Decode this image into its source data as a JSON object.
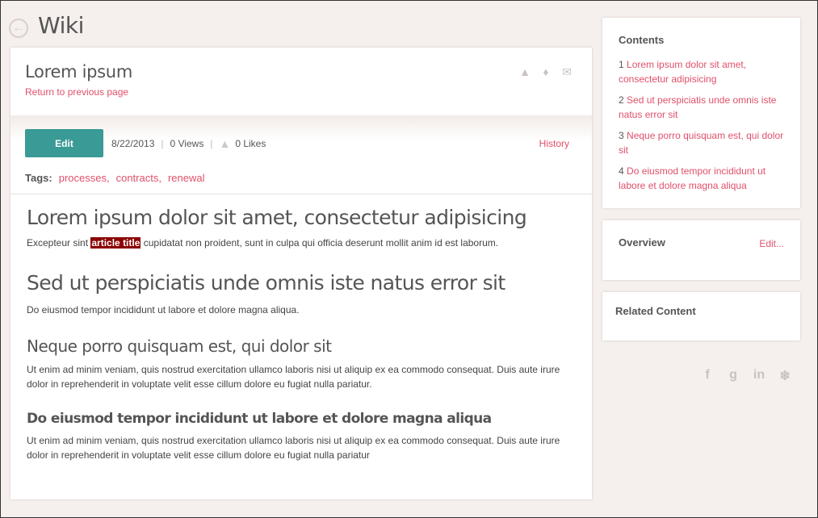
{
  "header": {
    "title": "Wiki",
    "back_icon": "arrow-left-circle-icon"
  },
  "article": {
    "title": "Lorem ipsum",
    "return_link": "Return to previous page",
    "actions": {
      "edit_label": "Edit",
      "history_label": "History"
    },
    "meta": {
      "date": "8/22/2013",
      "views": "0 Views",
      "likes": "0 Likes"
    },
    "tags_label": "Tags:",
    "tags": [
      "processes",
      "contracts",
      "renewal"
    ],
    "sections": [
      {
        "heading": "Lorem ipsum dolor sit amet, consectetur adipisicing",
        "text_before": "Excepteur sint ",
        "highlight": "article title",
        "text_after": " cupidatat non proident, sunt in culpa qui officia deserunt mollit anim id est laborum."
      },
      {
        "heading": "Sed ut perspiciatis unde omnis iste natus error sit",
        "text": "Do eiusmod tempor incididunt ut labore et dolore magna aliqua."
      },
      {
        "heading": "Neque porro quisquam est, qui dolor sit",
        "text": "Ut enim ad minim veniam, quis nostrud exercitation ullamco laboris nisi ut aliquip ex ea commodo consequat. Duis aute irure dolor in reprehenderit in voluptate velit esse cillum dolore eu fugiat nulla pariatur."
      },
      {
        "heading": "Do eiusmod tempor incididunt ut labore et dolore magna aliqua",
        "text": "Ut enim ad minim veniam, quis nostrud exercitation ullamco laboris nisi ut aliquip ex ea commodo consequat. Duis aute irure dolor in reprehenderit in voluptate velit esse cillum dolore eu fugiat nulla pariatur"
      }
    ]
  },
  "sidebar": {
    "contents": {
      "title": "Contents",
      "items": [
        {
          "num": "1",
          "label": "Lorem ipsum dolor sit amet, consectetur adipisicing"
        },
        {
          "num": "2",
          "label": "Sed ut perspiciatis unde omnis iste natus error sit"
        },
        {
          "num": "3",
          "label": "Neque porro quisquam est, qui dolor sit"
        },
        {
          "num": "4",
          "label": "Do eiusmod tempor incididunt ut labore et dolore magna aliqua"
        }
      ]
    },
    "overview": {
      "title": "Overview",
      "edit_label": "Edit..."
    },
    "related": {
      "title": "Related Content"
    },
    "social_icons": [
      "facebook-icon",
      "google-plus-icon",
      "linkedin-icon",
      "twitter-icon"
    ]
  },
  "colors": {
    "accent": "#e0506a",
    "button": "#3a9a95",
    "highlight": "#8b0000",
    "background": "#f5efed"
  }
}
